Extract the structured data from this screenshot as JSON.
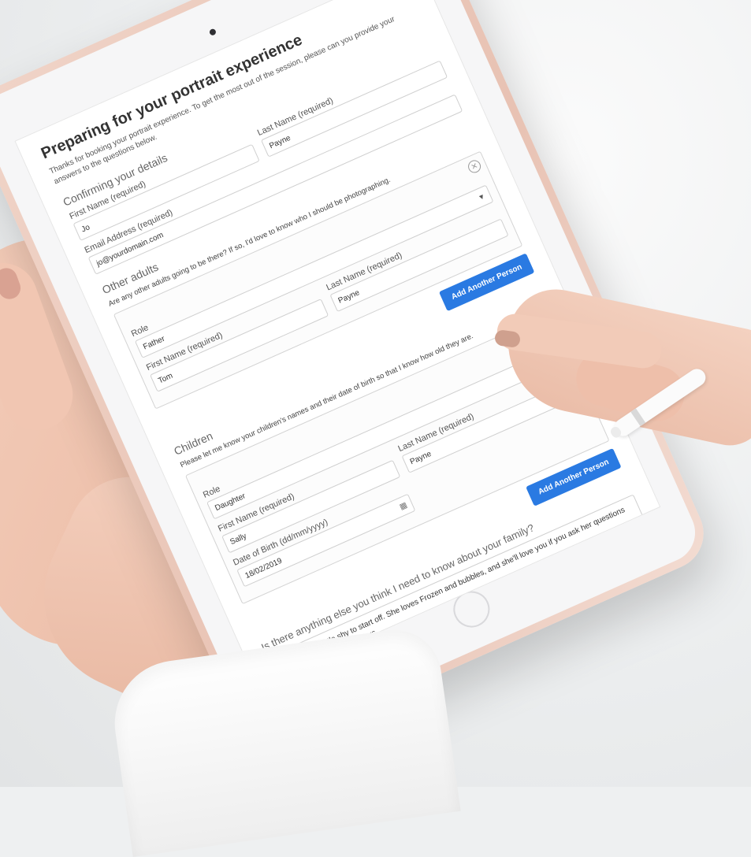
{
  "form": {
    "title": "Preparing for your portrait experience",
    "intro": "Thanks for booking your portrait experience. To get the most out of the session, please can you provide your answers to the questions below.",
    "details": {
      "heading": "Confirming your details",
      "first_name_label": "First Name (required)",
      "first_name_value": "Jo",
      "last_name_label": "Last Name (required)",
      "last_name_value": "Payne",
      "email_label": "Email Address (required)",
      "email_value": "jo@yourdomain.com"
    },
    "other_adults": {
      "heading": "Other adults",
      "hint": "Are any other adults going to be there? If so, I'd love to know who I should be photographing.",
      "role_label": "Role",
      "role_value": "Father",
      "first_name_label": "First Name (required)",
      "first_name_value": "Tom",
      "last_name_label": "Last Name (required)",
      "last_name_value": "Payne",
      "add_button": "Add Another Person"
    },
    "children": {
      "heading": "Children",
      "hint": "Please let me know your children's names and their date of birth so that I know how old they are.",
      "role_label": "Role",
      "role_value": "Daughter",
      "first_name_label": "First Name (required)",
      "first_name_value": "Sally",
      "last_name_label": "Last Name (required)",
      "last_name_value": "Payne",
      "dob_label": "Date of Birth (dd/mm/yyyy)",
      "dob_value": "18/02/2019",
      "add_button": "Add Another Person"
    },
    "anything_else": {
      "question": "Is there anything else you think I need to know about your family?",
      "answer": "Sally can be a little shy to start off. She loves Frozen and bubbles, and she'll love you if you ask her questions about her favourite characters."
    }
  },
  "icons": {
    "select": "chevron-down-icon",
    "remove": "close-icon",
    "calendar": "calendar-icon"
  },
  "colors": {
    "accent": "#2a7ae2",
    "tablet_frame": "#e8c2b3",
    "background": "#eef0f1"
  }
}
